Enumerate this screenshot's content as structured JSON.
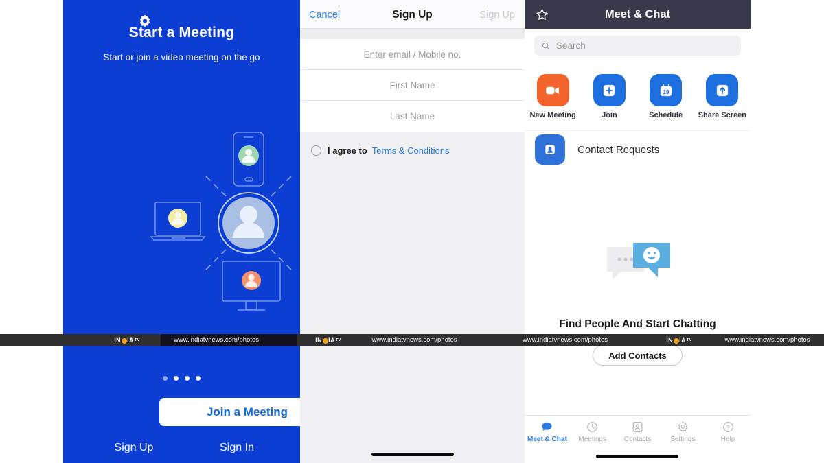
{
  "screen1": {
    "name": "onboarding-start-meeting",
    "background_color": "#0d3ed4",
    "settings_icon": "gear-icon",
    "title": "Start a Meeting",
    "subtitle": "Start or join a video meeting on the go",
    "illustration": {
      "name": "devices-connected-illustration",
      "center_avatar": "person-icon",
      "devices": [
        "phone",
        "laptop",
        "tablet",
        "desktop-monitor"
      ],
      "avatar_colors": [
        "#8fc4a0",
        "#f2e7a0",
        "#f5c76e",
        "#f08a6b"
      ]
    },
    "page_dots": {
      "count": 4,
      "active_index": 0
    },
    "join_button": "Join a Meeting",
    "join_button_color": "#1268d4",
    "sign_up": "Sign Up",
    "sign_in": "Sign In"
  },
  "screen2": {
    "name": "sign-up-form",
    "nav": {
      "cancel": "Cancel",
      "title": "Sign Up",
      "action": "Sign Up",
      "action_disabled": true
    },
    "fields": [
      {
        "placeholder": "Enter email / Mobile no.",
        "value": ""
      },
      {
        "placeholder": "First Name",
        "value": ""
      },
      {
        "placeholder": "Last Name",
        "value": ""
      }
    ],
    "agree": {
      "checked": false,
      "label": "I agree to",
      "link": "Terms & Conditions",
      "link_color": "#2a7ae2"
    }
  },
  "screen3": {
    "name": "meet-and-chat",
    "nav": {
      "star_icon": "star-icon",
      "title": "Meet & Chat",
      "background_color": "#383a4c"
    },
    "search": {
      "placeholder": "Search",
      "value": "",
      "icon": "search-icon"
    },
    "actions": [
      {
        "label": "New Meeting",
        "icon": "video-camera-icon",
        "color": "#f1632a"
      },
      {
        "label": "Join",
        "icon": "plus-icon",
        "color": "#1d6fe0"
      },
      {
        "label": "Schedule",
        "icon": "calendar-icon",
        "color": "#1d6fe0",
        "day": "19"
      },
      {
        "label": "Share Screen",
        "icon": "arrow-up-icon",
        "color": "#1d6fe0"
      }
    ],
    "contact_requests": {
      "label": "Contact Requests",
      "icon": "contact-card-icon",
      "color": "#2d71d9"
    },
    "empty_state": {
      "illustration": "chat-bubbles-icon",
      "title": "Find People And Start Chatting",
      "button": "Add Contacts"
    },
    "tabs": [
      {
        "label": "Meet & Chat",
        "icon": "chat-bubble-icon",
        "active": true
      },
      {
        "label": "Meetings",
        "icon": "clock-icon",
        "active": false
      },
      {
        "label": "Contacts",
        "icon": "contact-icon",
        "active": false
      },
      {
        "label": "Settings",
        "icon": "gear-icon",
        "active": false
      },
      {
        "label": "Help",
        "icon": "question-mark-icon",
        "active": false
      }
    ]
  },
  "watermark": {
    "logo_text_1": "IN",
    "logo_text_2": "IA",
    "logo_superscript": "TV",
    "url": "www.indiatvnews.com/photos"
  }
}
